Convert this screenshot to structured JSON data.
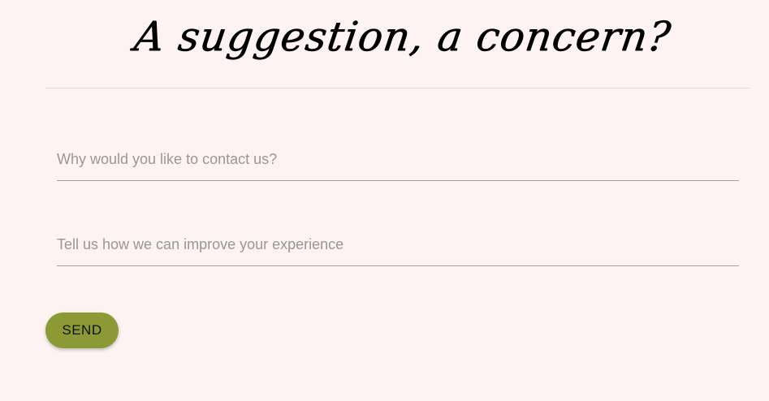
{
  "heading": {
    "text": "A suggestion, a concern?"
  },
  "form": {
    "reason_field": {
      "value": "",
      "placeholder": "Why would you like to contact us?"
    },
    "feedback_field": {
      "value": "",
      "placeholder": "Tell us how we can improve your experience"
    },
    "send_label": "SEND"
  },
  "colors": {
    "background": "#fdf3f2",
    "button": "#8c9a35",
    "underline": "#a59e9d"
  }
}
